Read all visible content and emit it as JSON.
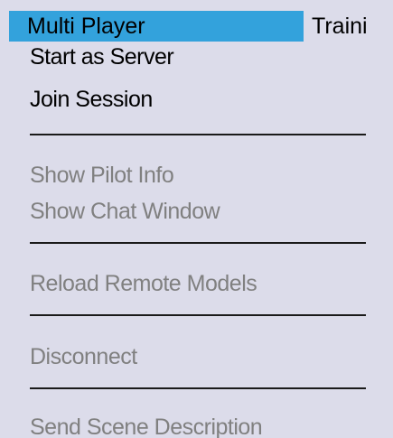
{
  "menubar": {
    "items": [
      {
        "label": "Multi Player",
        "active": true
      },
      {
        "label": "Traini",
        "active": false
      }
    ],
    "active_color": "#33a2dc",
    "background_color": "#dcdcea"
  },
  "dropdown": {
    "items": [
      {
        "label": "Start as Server",
        "enabled": true
      },
      {
        "label": "Join Session",
        "enabled": true
      },
      {
        "separator": true
      },
      {
        "label": "Show Pilot Info",
        "enabled": false
      },
      {
        "label": "Show Chat Window",
        "enabled": false
      },
      {
        "separator": true
      },
      {
        "label": "Reload Remote Models",
        "enabled": false
      },
      {
        "separator": true
      },
      {
        "label": "Disconnect",
        "enabled": false
      },
      {
        "separator": true
      },
      {
        "label": "Send Scene Description",
        "enabled": false
      }
    ],
    "enabled_color": "#000000",
    "disabled_color": "#808080"
  }
}
